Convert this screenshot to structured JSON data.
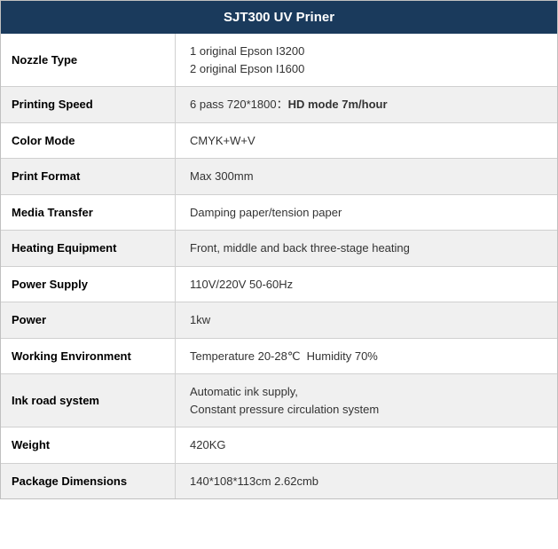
{
  "header": {
    "title": "SJT300 UV Priner"
  },
  "rows": [
    {
      "id": "nozzle-type",
      "label": "Nozzle Type",
      "value": "1 original Epson I3200\n2 original Epson I1600",
      "multiline": true,
      "bold_suffix": null,
      "even": false
    },
    {
      "id": "printing-speed",
      "label": "Printing Speed",
      "value_prefix": "6 pass 720*1800：",
      "value_bold": "HD mode 7m/hour",
      "multiline": false,
      "even": true
    },
    {
      "id": "color-mode",
      "label": "Color Mode",
      "value": "CMYK+W+V",
      "multiline": false,
      "even": false
    },
    {
      "id": "print-format",
      "label": "Print Format",
      "value": "Max 300mm",
      "multiline": false,
      "even": true
    },
    {
      "id": "media-transfer",
      "label": "Media Transfer",
      "value": "Damping paper/tension paper",
      "multiline": false,
      "even": false
    },
    {
      "id": "heating-equipment",
      "label": "Heating Equipment",
      "value": "Front, middle and back three-stage heating",
      "multiline": false,
      "even": true
    },
    {
      "id": "power-supply",
      "label": "Power Supply",
      "value": "110V/220V 50-60Hz",
      "multiline": false,
      "even": false
    },
    {
      "id": "power",
      "label": "Power",
      "value": "1kw",
      "multiline": false,
      "even": true
    },
    {
      "id": "working-environment",
      "label": "Working Environment",
      "value": "Temperature 20-28℃  Humidity 70%",
      "multiline": false,
      "even": false
    },
    {
      "id": "ink-road-system",
      "label": "Ink road system",
      "value": "Automatic ink supply,\nConstant pressure circulation system",
      "multiline": true,
      "even": true
    },
    {
      "id": "weight",
      "label": "Weight",
      "value": "420KG",
      "multiline": false,
      "even": false
    },
    {
      "id": "package-dimensions",
      "label": "Package Dimensions",
      "value": "140*108*113cm  2.62cmb",
      "multiline": false,
      "even": true
    }
  ]
}
